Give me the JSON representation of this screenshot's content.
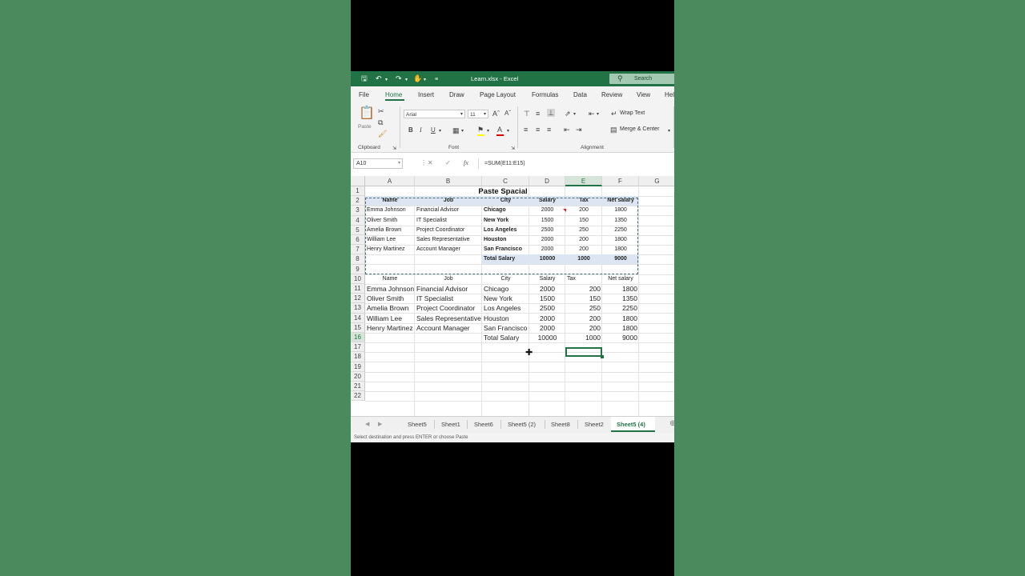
{
  "app": {
    "title": "Learn.xlsx  -  Excel",
    "search_label": "Search"
  },
  "menu": {
    "tabs": [
      "File",
      "Home",
      "Insert",
      "Draw",
      "Page Layout",
      "Formulas",
      "Data",
      "Review",
      "View",
      "Hel"
    ]
  },
  "ribbon": {
    "paste_label": "Paste",
    "font_name": "Arial",
    "font_size": "11",
    "bold": "B",
    "italic": "I",
    "underline": "U",
    "wrap_text": "Wrap Text",
    "merge_center": "Merge & Center",
    "groups": [
      "Clipboard",
      "Font",
      "Alignment"
    ]
  },
  "formula_bar": {
    "name_box": "A10",
    "fx": "fx",
    "formula": "=SUM(E11:E15)"
  },
  "columns": [
    "A",
    "B",
    "C",
    "D",
    "E",
    "F",
    "G"
  ],
  "rows": [
    "1",
    "2",
    "3",
    "4",
    "5",
    "6",
    "7",
    "8",
    "9",
    "10",
    "11",
    "12",
    "13",
    "14",
    "15",
    "16",
    "17",
    "18",
    "19",
    "20",
    "21",
    "22"
  ],
  "sheet": {
    "title": "Paste Spacial",
    "table1": {
      "headers": [
        "Name",
        "Job",
        "City",
        "Salary",
        "Tax",
        "Net salary"
      ],
      "rows": [
        [
          "Emma Johnson",
          "Financial Advisor",
          "Chicago",
          "2000",
          "200",
          "1800"
        ],
        [
          "Oliver Smith",
          "IT Specialist",
          "New York",
          "1500",
          "150",
          "1350"
        ],
        [
          "Amelia Brown",
          "Project Coordinator",
          "Los Angeles",
          "2500",
          "250",
          "2250"
        ],
        [
          "William Lee",
          "Sales Representative",
          "Houston",
          "2000",
          "200",
          "1800"
        ],
        [
          "Henry Martinez",
          "Account Manager",
          "San Francisco",
          "2000",
          "200",
          "1800"
        ]
      ],
      "total": [
        "Total Salary",
        "10000",
        "1000",
        "9000"
      ]
    },
    "table2": {
      "headers": [
        "Name",
        "Job",
        "City",
        "Salary",
        "Tax",
        "Net salary"
      ],
      "rows": [
        [
          "Emma Johnson",
          "Financial Advisor",
          "Chicago",
          "2000",
          "200",
          "1800"
        ],
        [
          "Oliver Smith",
          "IT Specialist",
          "New York",
          "1500",
          "150",
          "1350"
        ],
        [
          "Amelia Brown",
          "Project Coordinator",
          "Los Angeles",
          "2500",
          "250",
          "2250"
        ],
        [
          "William Lee",
          "Sales Representative",
          "Houston",
          "2000",
          "200",
          "1800"
        ],
        [
          "Henry Martinez",
          "Account Manager",
          "San Francisco",
          "2000",
          "200",
          "1800"
        ]
      ],
      "total": [
        "Total Salary",
        "10000",
        "1000",
        "9000"
      ]
    }
  },
  "sheet_tabs": [
    "Sheet5",
    "Sheet1",
    "Sheet6",
    "Sheet5 (2)",
    "Sheet8",
    "Sheet2",
    "Sheet5 (4)"
  ],
  "status": "Select destination and press ENTER or choose Paste"
}
